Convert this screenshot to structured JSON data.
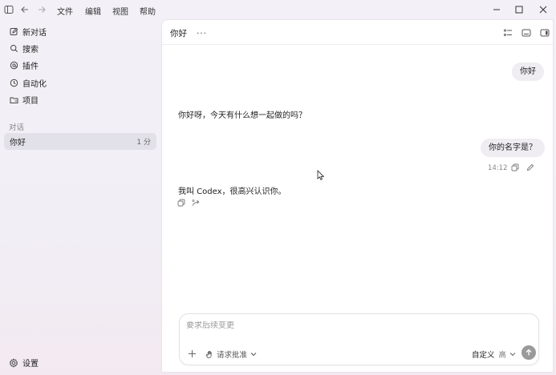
{
  "menubar": {
    "items": [
      "文件",
      "编辑",
      "视图",
      "帮助"
    ]
  },
  "sidebar": {
    "nav": [
      {
        "label": "新对话",
        "icon": "edit-icon"
      },
      {
        "label": "搜索",
        "icon": "search-icon"
      },
      {
        "label": "插件",
        "icon": "plugin-icon"
      },
      {
        "label": "自动化",
        "icon": "clock-icon"
      },
      {
        "label": "项目",
        "icon": "folder-icon"
      }
    ],
    "section_label": "对话",
    "conversations": [
      {
        "title": "你好",
        "time": "1 分"
      }
    ],
    "settings_label": "设置"
  },
  "header": {
    "title": "你好",
    "more": "···"
  },
  "messages": [
    {
      "role": "user",
      "text": "你好"
    },
    {
      "role": "assistant",
      "text": "你好呀，今天有什么想一起做的吗？"
    },
    {
      "role": "user",
      "text": "你的名字是？",
      "time": "14:12"
    },
    {
      "role": "assistant",
      "text": "我叫 Codex，很高兴认识你。"
    }
  ],
  "composer": {
    "placeholder": "要求后续变更",
    "approval_label": "请求批准",
    "mode_label": "自定义",
    "level_label": "高"
  },
  "colors": {
    "send_button": "#9a9a9a",
    "bubble": "#efedf2",
    "selected_conversation": "#e2e0e8"
  }
}
